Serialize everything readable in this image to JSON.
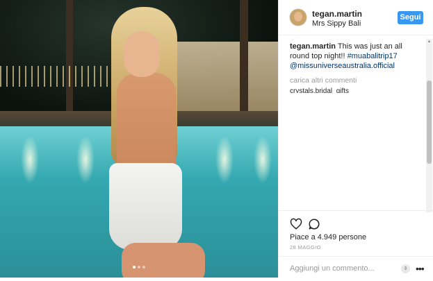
{
  "post": {
    "username": "tegan.martin",
    "location": "Mrs Sippy Bali",
    "follow_label": "Segui",
    "caption": {
      "user": "tegan.martin",
      "text": " This was just an all round top night!! ",
      "hashtag": "#muabalitrip17",
      "mention": "@missuniverseaustralia.official"
    },
    "load_more": "carica altri commenti",
    "partial_comment": "crystals.bridal_gifts",
    "likes": "Piace a 4.949 persone",
    "date": "28 MAGGIO",
    "comment_placeholder": "Aggiungi un commento...",
    "carousel": {
      "count": 3,
      "active_index": 0
    }
  },
  "icons": {
    "like": "heart-outline-icon",
    "comment": "speech-bubble-icon",
    "more": "ellipsis-icon"
  },
  "colors": {
    "follow_button": "#3897f0",
    "link": "#003569",
    "secondary_text": "#999999"
  }
}
